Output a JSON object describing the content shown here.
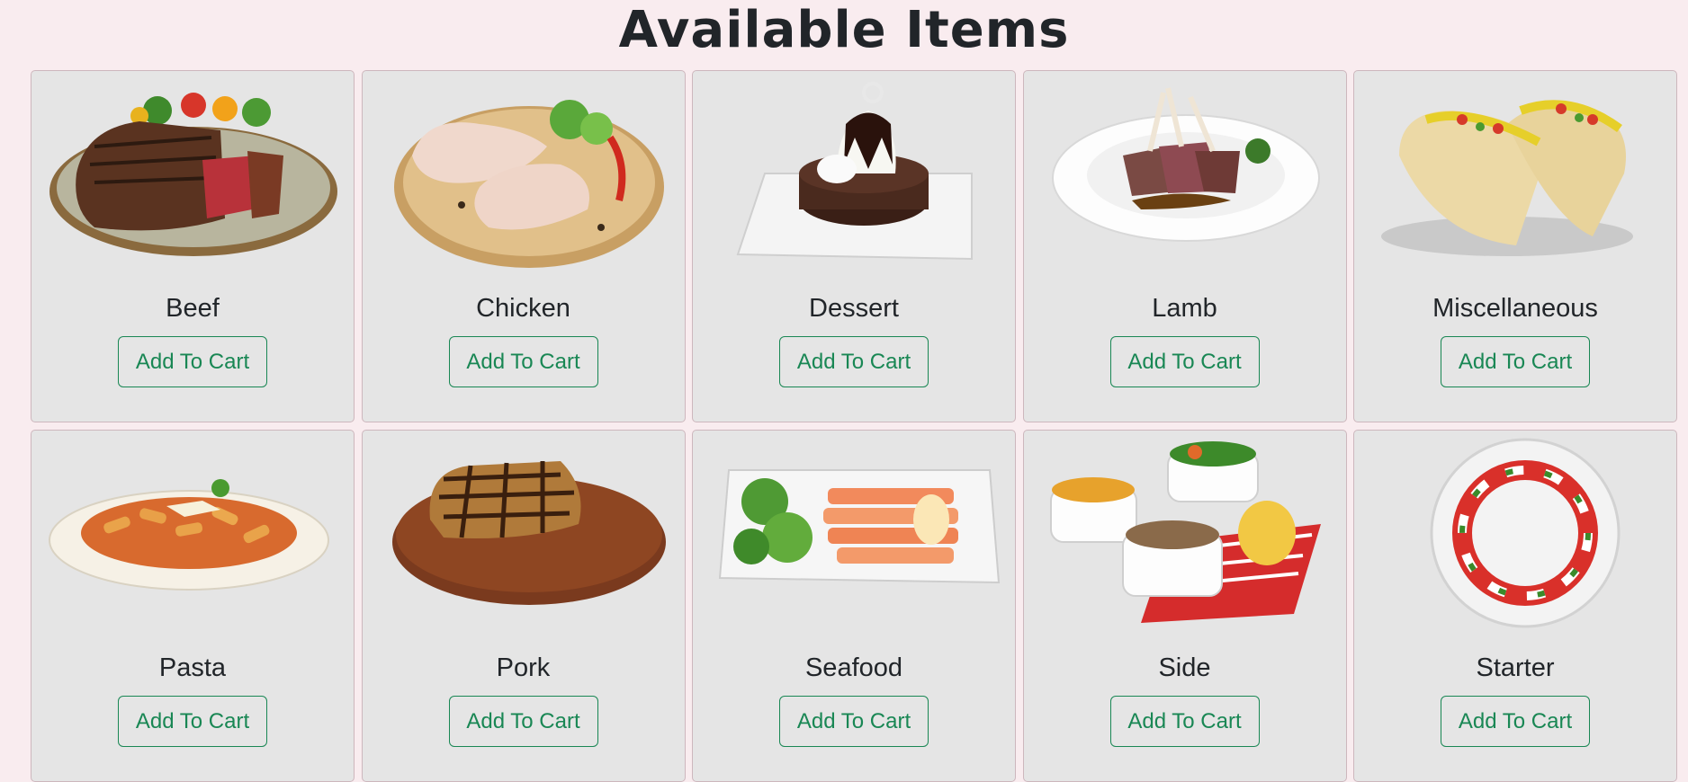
{
  "page": {
    "title": "Available Items"
  },
  "items": [
    {
      "name": "Beef",
      "button": "Add To Cart",
      "icon": "steak-plate-image"
    },
    {
      "name": "Chicken",
      "button": "Add To Cart",
      "icon": "chicken-board-image"
    },
    {
      "name": "Dessert",
      "button": "Add To Cart",
      "icon": "chocolate-cake-image"
    },
    {
      "name": "Lamb",
      "button": "Add To Cart",
      "icon": "lamb-chops-image"
    },
    {
      "name": "Miscellaneous",
      "button": "Add To Cart",
      "icon": "tacos-image"
    },
    {
      "name": "Pasta",
      "button": "Add To Cart",
      "icon": "penne-bowl-image"
    },
    {
      "name": "Pork",
      "button": "Add To Cart",
      "icon": "pork-chop-image"
    },
    {
      "name": "Seafood",
      "button": "Add To Cart",
      "icon": "salmon-plate-image"
    },
    {
      "name": "Side",
      "button": "Add To Cart",
      "icon": "side-dishes-image"
    },
    {
      "name": "Starter",
      "button": "Add To Cart",
      "icon": "caprese-wreath-image"
    }
  ],
  "colors": {
    "page_background": "#f9ecef",
    "card_background": "#e5e5e5",
    "button_accent": "#198754",
    "text": "#212529"
  }
}
